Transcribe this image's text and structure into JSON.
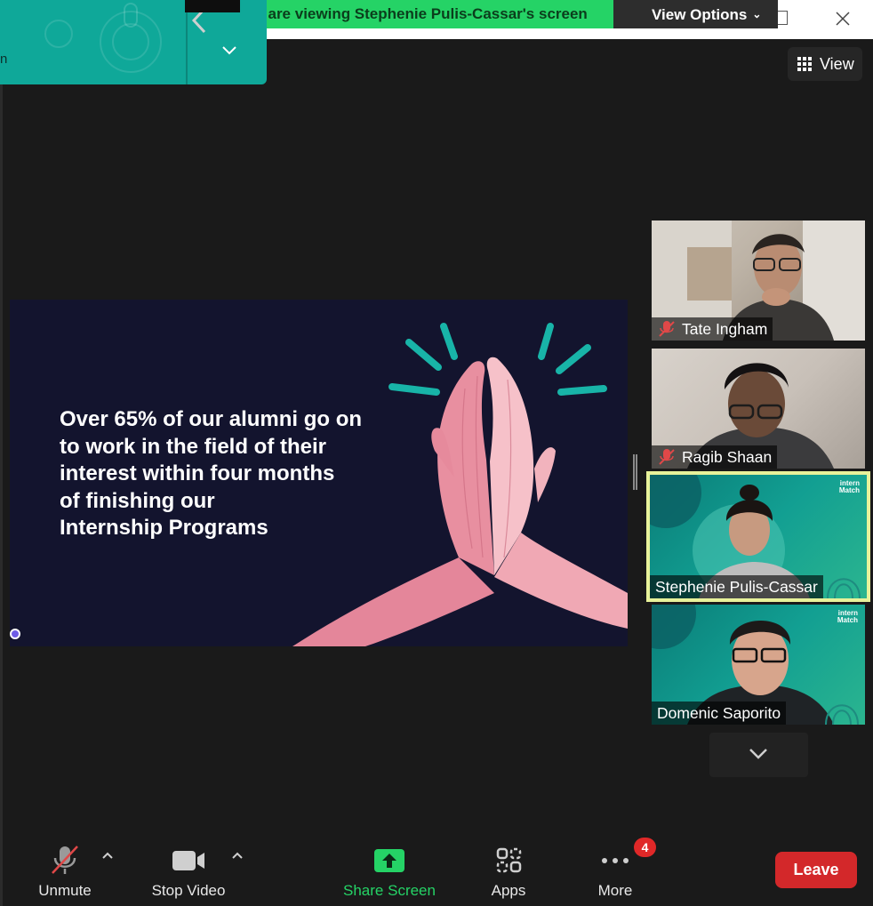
{
  "banner": {
    "text": "ou are viewing Stephenie Pulis-Cassar's screen",
    "view_options_label": "View Options"
  },
  "floating_panel": {
    "fragment_text": "n"
  },
  "view_button": {
    "label": "View"
  },
  "slide": {
    "lines": [
      "Over 65% of our alumni go on",
      "to work in the field of their",
      "interest within four months",
      "of finishing our",
      "Internship Programs"
    ]
  },
  "participants": [
    {
      "name": "Tate Ingham",
      "muted": true,
      "active": false
    },
    {
      "name": "Ragib Shaan",
      "muted": true,
      "active": false
    },
    {
      "name": "Stephenie Pulis-Cassar",
      "muted": false,
      "active": true,
      "logo": [
        "intern",
        "Match"
      ]
    },
    {
      "name": "Domenic Saporito",
      "muted": false,
      "active": false,
      "logo": [
        "intern",
        "Match"
      ]
    }
  ],
  "toolbar": {
    "unmute_label": "Unmute",
    "stop_video_label": "Stop Video",
    "share_screen_label": "Share Screen",
    "apps_label": "Apps",
    "more_label": "More",
    "more_badge": "4",
    "leave_label": "Leave"
  },
  "colors": {
    "banner_green": "#25d366",
    "panel_teal": "#0fa899",
    "active_speaker_border": "#e8f29a",
    "leave_red": "#d3282a",
    "slide_bg": "#13142e",
    "slide_accent": "#18b4a8"
  }
}
